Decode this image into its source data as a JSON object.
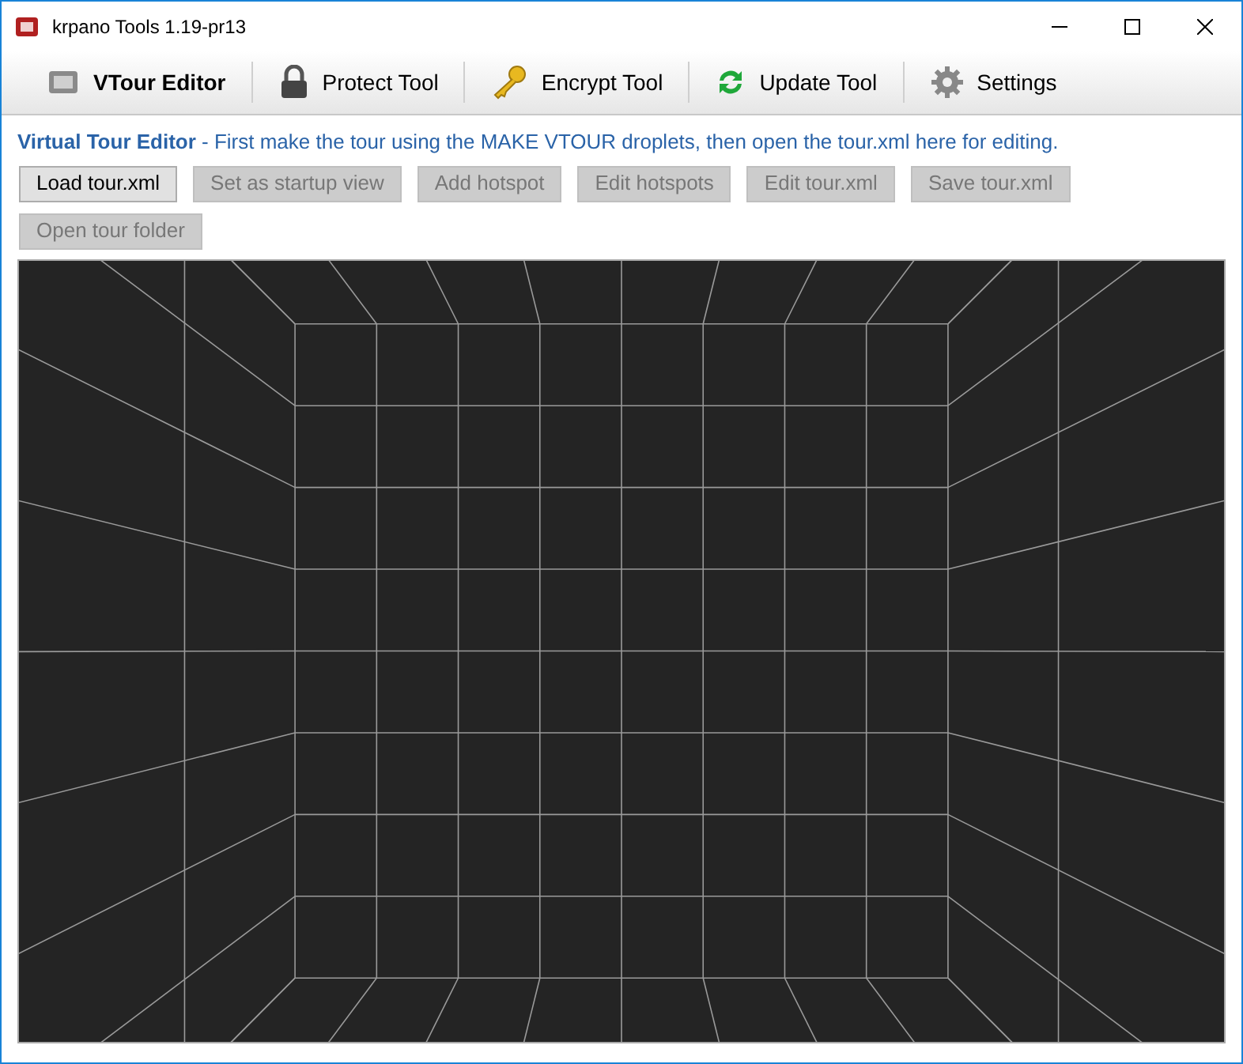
{
  "window": {
    "title": "krpano Tools 1.19-pr13"
  },
  "tabs": [
    {
      "label": "VTour Editor",
      "selected": true
    },
    {
      "label": "Protect Tool",
      "selected": false
    },
    {
      "label": "Encrypt Tool",
      "selected": false
    },
    {
      "label": "Update Tool",
      "selected": false
    },
    {
      "label": "Settings",
      "selected": false
    }
  ],
  "intro": {
    "title": "Virtual Tour Editor",
    "text": " - First make the tour using the MAKE VTOUR droplets, then open the tour.xml here for editing."
  },
  "buttons": [
    {
      "label": "Load tour.xml",
      "disabled": false
    },
    {
      "label": "Set as startup view",
      "disabled": true
    },
    {
      "label": "Add hotspot",
      "disabled": true
    },
    {
      "label": "Edit hotspots",
      "disabled": true
    },
    {
      "label": "Edit tour.xml",
      "disabled": true
    },
    {
      "label": "Save tour.xml",
      "disabled": true
    },
    {
      "label": "Open tour folder",
      "disabled": true
    }
  ]
}
